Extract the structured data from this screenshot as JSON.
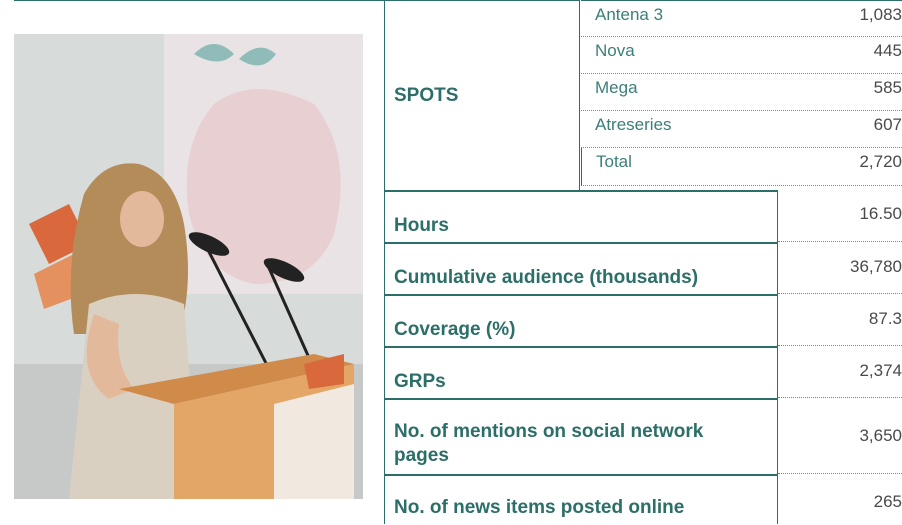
{
  "spots": {
    "label": "SPOTS",
    "rows": [
      {
        "channel": "Antena 3",
        "value": "1,083"
      },
      {
        "channel": "Nova",
        "value": "445"
      },
      {
        "channel": "Mega",
        "value": "585"
      },
      {
        "channel": "Atreseries",
        "value": "607"
      },
      {
        "channel": "Total",
        "value": "2,720"
      }
    ]
  },
  "metrics": [
    {
      "label": "Hours",
      "value": "16.50"
    },
    {
      "label": "Cumulative audience (thousands)",
      "value": "36,780"
    },
    {
      "label": "Coverage (%)",
      "value": "87.3"
    },
    {
      "label": "GRPs",
      "value": "2,374"
    },
    {
      "label": "No. of mentions on social network pages",
      "value": "3,650"
    },
    {
      "label": "No. of news items posted online",
      "value": "265"
    }
  ],
  "colors": {
    "accent": "#2c6e68",
    "value_text": "#4a4a4a"
  },
  "photo": {
    "icon": "speaker-photo"
  }
}
